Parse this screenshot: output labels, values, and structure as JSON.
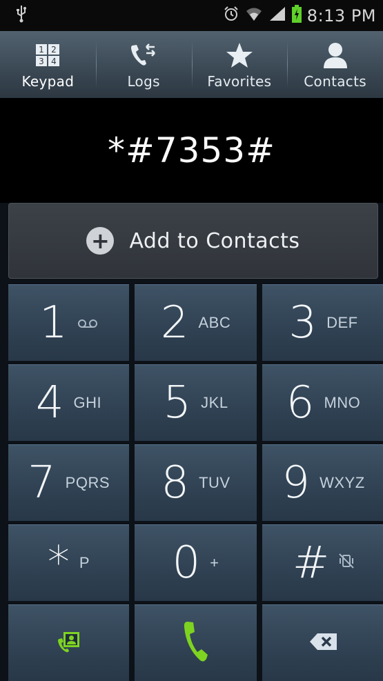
{
  "status_bar": {
    "time": "8:13 PM",
    "icons": [
      "usb-icon",
      "alarm-icon",
      "wifi-icon",
      "signal-icon",
      "battery-charging-icon"
    ]
  },
  "tabs": [
    {
      "label": "Keypad",
      "icon": "keypad-icon",
      "active": true
    },
    {
      "label": "Logs",
      "icon": "logs-icon",
      "active": false
    },
    {
      "label": "Favorites",
      "icon": "star-icon",
      "active": false
    },
    {
      "label": "Contacts",
      "icon": "person-icon",
      "active": false
    }
  ],
  "display": {
    "number": "*#7353#"
  },
  "add_to_contacts": {
    "label": "Add to Contacts",
    "icon": "plus-circle-icon"
  },
  "keys": [
    {
      "digit": "1",
      "letters": ""
    },
    {
      "digit": "2",
      "letters": "ABC"
    },
    {
      "digit": "3",
      "letters": "DEF"
    },
    {
      "digit": "4",
      "letters": "GHI"
    },
    {
      "digit": "5",
      "letters": "JKL"
    },
    {
      "digit": "6",
      "letters": "MNO"
    },
    {
      "digit": "7",
      "letters": "PQRS"
    },
    {
      "digit": "8",
      "letters": "TUV"
    },
    {
      "digit": "9",
      "letters": "WXYZ"
    },
    {
      "digit": "*",
      "letters": "P"
    },
    {
      "digit": "0",
      "letters": "+"
    },
    {
      "digit": "#",
      "letters": ""
    }
  ],
  "colors": {
    "accent_green": "#7ed321",
    "tab_underline": "#8fc6e8",
    "key_bg": "#2f4152"
  }
}
